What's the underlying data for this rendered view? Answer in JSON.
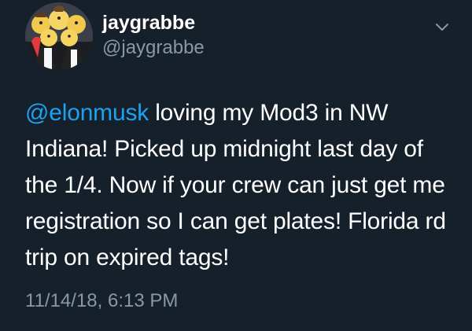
{
  "tweet": {
    "author": {
      "display_name": "jaygrabbe",
      "handle": "@jaygrabbe",
      "avatar": "avatar-cartoon-group-photo"
    },
    "menu_icon": "chevron-down-icon",
    "mention": "@elonmusk",
    "text": " loving my Mod3 in NW Indiana! Picked up midnight last day of the 1/4. Now if your crew can just get me registration so I can get plates! Florida rd trip on expired tags!",
    "timestamp": "11/14/18, 6:13 PM"
  },
  "colors": {
    "background": "#15202b",
    "text": "#ffffff",
    "secondary_text": "#8899a6",
    "mention_link": "#1da1f2"
  }
}
